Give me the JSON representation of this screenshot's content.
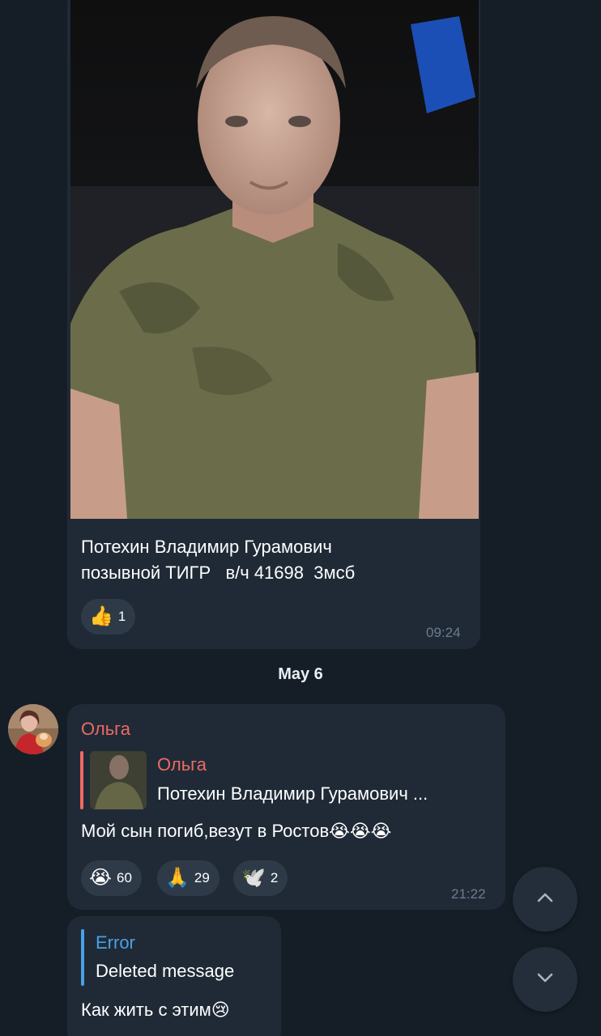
{
  "message_photo": {
    "caption_line1": "Потехин Владимир Гурамович",
    "caption_line2": "позывной ТИГР   в/ч 41698  3мсб",
    "reaction": {
      "emoji": "👍",
      "count": "1"
    },
    "time": "09:24"
  },
  "date_separator": "May 6",
  "message_olga": {
    "sender": "Ольга",
    "reply": {
      "name": "Ольга",
      "text": "Потехин Владимир Гурамович  ..."
    },
    "text": "Мой сын погиб,везут в Ростов😭😭😭",
    "reactions": [
      {
        "emoji": "😭",
        "count": "60"
      },
      {
        "emoji": "🙏",
        "count": "29"
      },
      {
        "emoji": "🕊️",
        "count": "2"
      }
    ],
    "time": "21:22"
  },
  "message_error": {
    "reply_title": "Error",
    "reply_text": "Deleted message",
    "text": "Как жить с этим😢"
  },
  "scroll_buttons": {
    "up_icon": "chevron-up-icon",
    "down_icon": "chevron-down-icon"
  },
  "colors": {
    "background": "#151e27",
    "bubble": "#1f2a36",
    "sender_accent": "#ee6a62",
    "error_accent": "#4aa0e6"
  }
}
